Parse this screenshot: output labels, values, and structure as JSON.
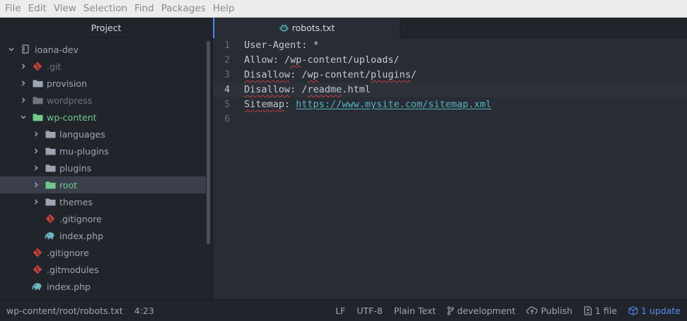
{
  "menubar": {
    "items": [
      "File",
      "Edit",
      "View",
      "Selection",
      "Find",
      "Packages",
      "Help"
    ]
  },
  "tree": {
    "header": "Project",
    "rows": [
      {
        "label": "ioana-dev",
        "icon": "repo-icon",
        "chevron": "down",
        "color": "#9da5b4"
      },
      {
        "label": ".git",
        "icon": "git-icon",
        "chevron": "right",
        "color": "#6e7580"
      },
      {
        "label": "provision",
        "icon": "folder-icon",
        "chevron": "right",
        "color": "#9da5b4"
      },
      {
        "label": "wordpress",
        "icon": "folder-icon",
        "chevron": "right",
        "color": "#6e7580"
      },
      {
        "label": "wp-content",
        "icon": "folder-icon",
        "chevron": "down",
        "color": "#73c990"
      },
      {
        "label": "languages",
        "icon": "folder-icon",
        "chevron": "right",
        "color": "#9da5b4"
      },
      {
        "label": "mu-plugins",
        "icon": "folder-icon",
        "chevron": "right",
        "color": "#9da5b4"
      },
      {
        "label": "plugins",
        "icon": "folder-icon",
        "chevron": "right",
        "color": "#9da5b4"
      },
      {
        "label": "root",
        "icon": "folder-icon",
        "chevron": "right",
        "color": "#73c990"
      },
      {
        "label": "themes",
        "icon": "folder-icon",
        "chevron": "right",
        "color": "#9da5b4"
      },
      {
        "label": ".gitignore",
        "icon": "git-icon",
        "chevron": "",
        "color": "#9da5b4"
      },
      {
        "label": "index.php",
        "icon": "php-elephant-icon",
        "chevron": "",
        "color": "#9da5b4"
      },
      {
        "label": ".gitignore",
        "icon": "git-icon",
        "chevron": "",
        "color": "#9da5b4"
      },
      {
        "label": ".gitmodules",
        "icon": "git-icon",
        "chevron": "",
        "color": "#9da5b4"
      },
      {
        "label": "index.php",
        "icon": "php-elephant-icon",
        "chevron": "",
        "color": "#9da5b4"
      }
    ]
  },
  "editor": {
    "tab_title": "robots.txt",
    "current_line": 4,
    "line_numbers": [
      "1",
      "2",
      "3",
      "4",
      "5",
      "6"
    ],
    "lines": [
      {
        "parts": [
          {
            "text": "User-Agent: *",
            "style": "plain"
          }
        ]
      },
      {
        "parts": [
          {
            "text": "Allow: /",
            "style": "plain"
          },
          {
            "text": "wp",
            "style": "spell"
          },
          {
            "text": "-content/uploads/",
            "style": "plain"
          }
        ]
      },
      {
        "parts": [
          {
            "text": "Disallow",
            "style": "spell"
          },
          {
            "text": ": /",
            "style": "plain"
          },
          {
            "text": "wp",
            "style": "spell"
          },
          {
            "text": "-content/",
            "style": "plain"
          },
          {
            "text": "plugins",
            "style": "spell"
          },
          {
            "text": "/",
            "style": "plain"
          }
        ]
      },
      {
        "parts": [
          {
            "text": "Disallow",
            "style": "spell"
          },
          {
            "text": ": /",
            "style": "plain"
          },
          {
            "text": "readme",
            "style": "spell"
          },
          {
            "text": ".html",
            "style": "plain"
          }
        ]
      },
      {
        "parts": [
          {
            "text": "Sitemap",
            "style": "spell"
          },
          {
            "text": ": ",
            "style": "plain"
          },
          {
            "text": "https://www.mysite.com/sitemap.xml",
            "style": "url"
          }
        ]
      },
      {
        "parts": []
      }
    ]
  },
  "statusbar": {
    "file_path": "wp-content/root/robots.txt",
    "cursor": "4:23",
    "line_ending": "LF",
    "encoding": "UTF-8",
    "grammar": "Plain Text",
    "branch": "development",
    "publish": "Publish",
    "changed_files": "1 file",
    "updates": "1 update"
  },
  "colors": {
    "accent": "#568af2",
    "git_icon": "#e05d44",
    "vcs_added": "#73c990",
    "php_icon": "#6fb3c3"
  }
}
